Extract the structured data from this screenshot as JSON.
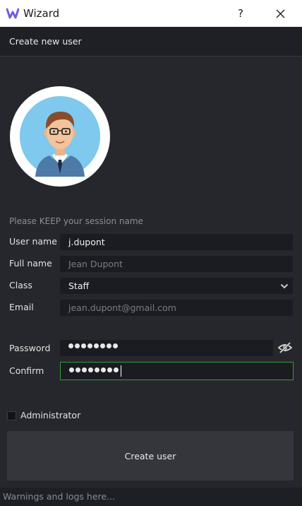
{
  "window": {
    "title": "Wizard",
    "help_label": "?",
    "logo_icon": "wizard-logo-icon",
    "close_icon": "close-icon"
  },
  "header": {
    "title": "Create new user"
  },
  "avatar": {
    "icon": "user-avatar-illustration"
  },
  "form": {
    "hint": "Please KEEP your session name",
    "username": {
      "label": "User name",
      "value": "j.dupont"
    },
    "fullname": {
      "label": "Full name",
      "placeholder": "Jean Dupont"
    },
    "class": {
      "label": "Class",
      "value": "Staff",
      "icon": "chevron-down-icon"
    },
    "email": {
      "label": "Email",
      "placeholder": "jean.dupont@gmail.com"
    },
    "password": {
      "label": "Password",
      "masked_length": 8,
      "icon": "eye-slash-icon"
    },
    "confirm": {
      "label": "Confirm",
      "masked_length": 8
    }
  },
  "admin": {
    "label": "Administrator",
    "checked": false
  },
  "actions": {
    "create_label": "Create user"
  },
  "statusbar": {
    "text": "Warnings and logs here..."
  },
  "colors": {
    "background": "#26272c",
    "field": "#1b1c21",
    "focus_border": "#2e9e3a",
    "logo": "#6f5ce6",
    "avatar_bg": "#7fc8ee"
  }
}
